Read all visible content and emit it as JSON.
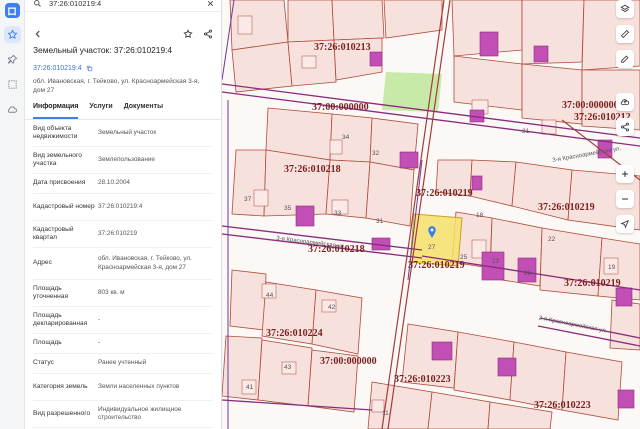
{
  "search": {
    "value": "37:26:010219:4"
  },
  "card": {
    "title": "Земельный участок: 37:26:010219:4",
    "number": "37:26:010219:4",
    "address": "обл. Ивановская, г. Тейково, ул. Красноармейская 3-я, дом 27"
  },
  "tabs": [
    {
      "label": "Информация"
    },
    {
      "label": "Услуги"
    },
    {
      "label": "Документы"
    }
  ],
  "rows": [
    {
      "k": "Вид объекта недвижимости",
      "v": "Земельный участок"
    },
    {
      "k": "Вид земельного участка",
      "v": "Землепользование"
    },
    {
      "k": "Дата присвоения",
      "v": "28.10.2004"
    },
    {
      "k": "Кадастровый номер",
      "v": "37:26:010219:4"
    },
    {
      "k": "Кадастровый квартал",
      "v": "37:26:010219"
    },
    {
      "k": "Адрес",
      "v": "обл. Ивановская, г. Тейково, ул. Красноармейская 3-я, дом 27"
    },
    {
      "k": "Площадь уточненная",
      "v": "803 кв. м"
    },
    {
      "k": "Площадь декларированная",
      "v": "-"
    },
    {
      "k": "Площадь",
      "v": "-"
    },
    {
      "k": "Статус",
      "v": "Ранее учтенный"
    },
    {
      "k": "Категория земель",
      "v": "Земли населенных пунктов"
    },
    {
      "k": "Вид разрешенного",
      "v": "Индивидуальное жилищное строительство"
    }
  ],
  "map": {
    "labels": [
      "37:26:010213",
      "37:00:000000",
      "37:26:010218",
      "37:26:010219",
      "37:26:010219",
      "37:26:010218",
      "37:26:010219",
      "37:26:010219",
      "37:26:010224",
      "37:00:000000",
      "37:26:010223",
      "37:26:010223",
      "37:00:000000",
      "37:26:010212"
    ],
    "house_numbers": [
      "34",
      "32",
      "37",
      "35",
      "33",
      "31",
      "44",
      "42",
      "43",
      "41",
      "27",
      "25",
      "23",
      "21",
      "26",
      "19",
      "18",
      "22",
      "11"
    ],
    "streets": [
      "3-я Красноармейская ул.",
      "2-я Красноармейская ул.",
      "3-я Красноармейская ул."
    ]
  },
  "colors": {
    "accent": "#3d7ff0",
    "parcel_fill": "#f7e1dc",
    "parcel_line": "#b04a3a",
    "building": "#c24fb5",
    "selected": "#f5e26a",
    "label": "#7a1f1f"
  }
}
